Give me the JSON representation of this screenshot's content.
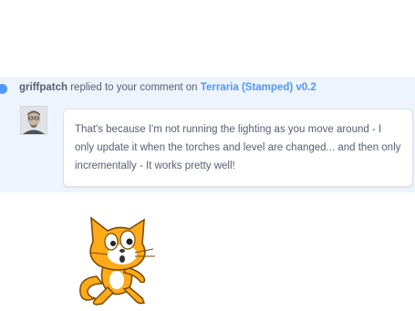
{
  "notification": {
    "username": "griffpatch",
    "action_text": " replied to your comment on ",
    "project_link": "Terraria (Stamped) v0.2",
    "comment": "That's because I'm not running the lighting as you move around - I only update it when the torches and level are changed... and then only incrementally - It works pretty well!"
  },
  "colors": {
    "row_background": "#eef4fb",
    "link_blue": "#4d97ff",
    "text_gray": "#575e75",
    "mascot_orange": "#ffab19"
  },
  "icons": {
    "avatar": "user-avatar",
    "mascot": "scratch-cat-icon"
  }
}
